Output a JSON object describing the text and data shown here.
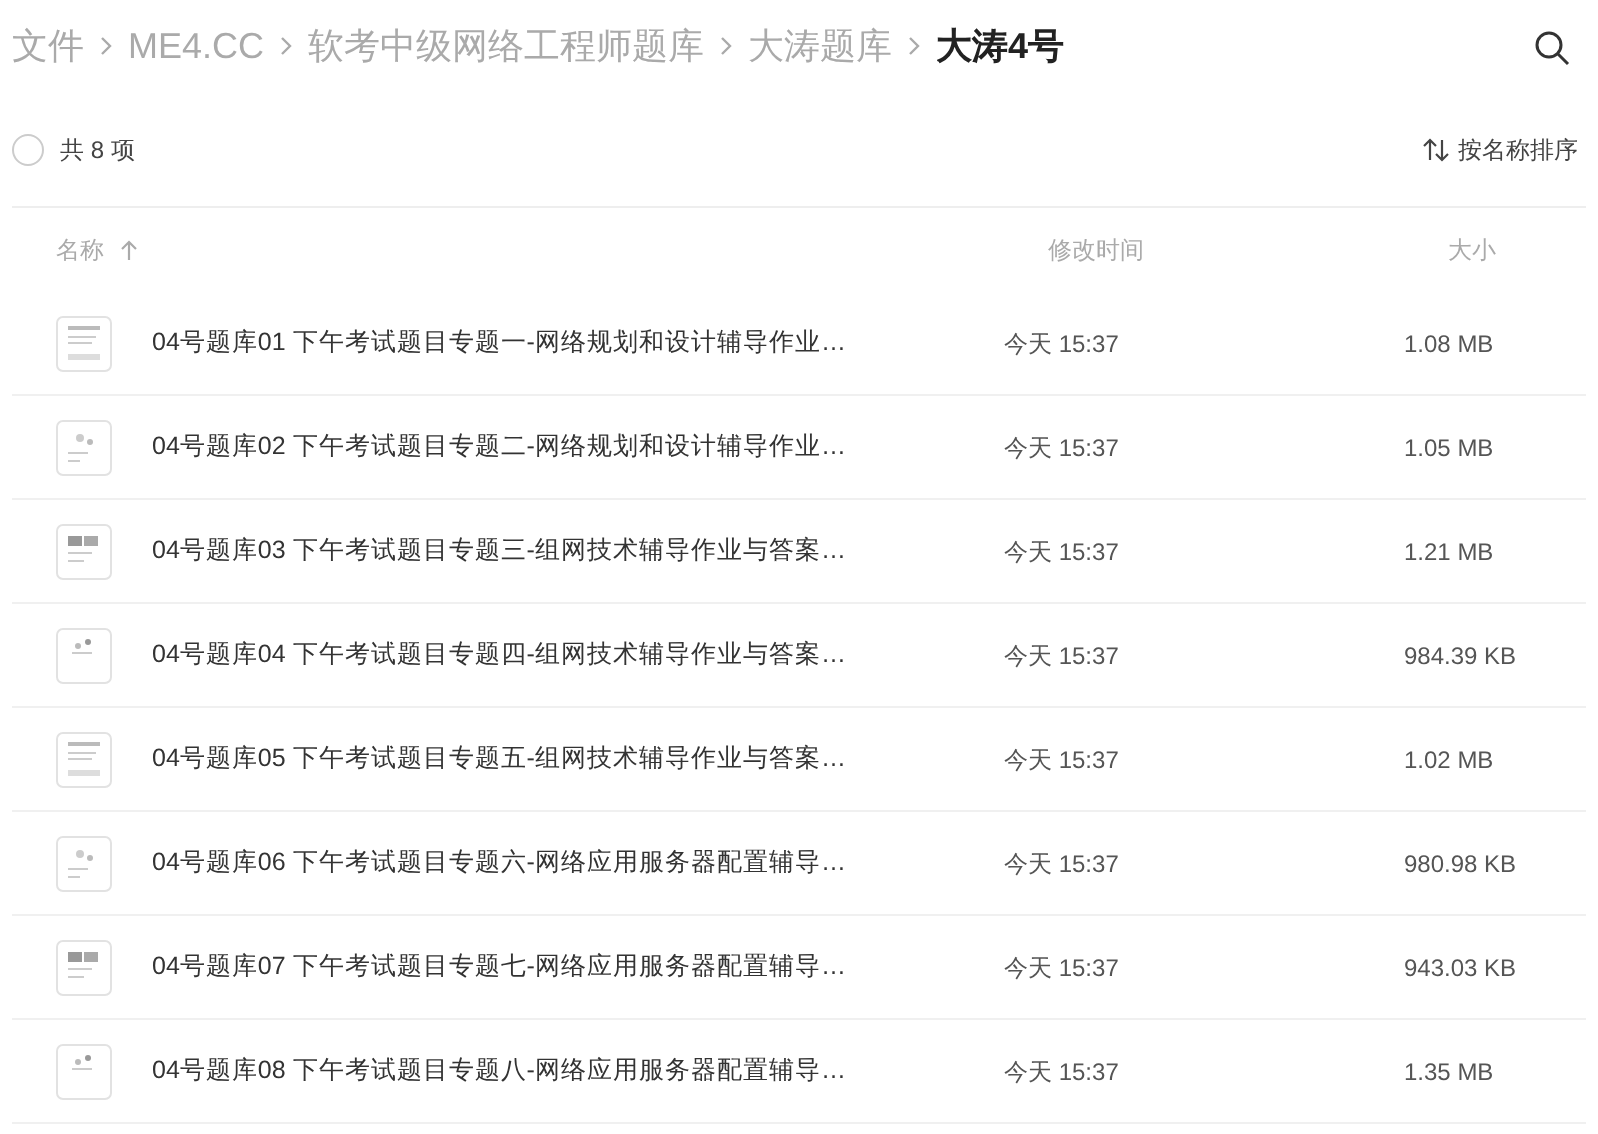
{
  "breadcrumb": [
    {
      "label": "文件",
      "current": false
    },
    {
      "label": "ME4.CC",
      "current": false
    },
    {
      "label": "软考中级网络工程师题库",
      "current": false
    },
    {
      "label": "大涛题库",
      "current": false
    },
    {
      "label": "大涛4号",
      "current": true
    }
  ],
  "selection": {
    "checked": false,
    "count_label": "共 8 项"
  },
  "sort": {
    "label": "按名称排序"
  },
  "columns": [
    {
      "label": "名称",
      "sorted": true
    },
    {
      "label": "修改时间",
      "sorted": false
    },
    {
      "label": "大小",
      "sorted": false
    }
  ],
  "files": [
    {
      "name": "04号题库01 下午考试题目专题一-网络规划和设计辅导作业…",
      "modified": "今天 15:37",
      "size": "1.08 MB"
    },
    {
      "name": "04号题库02 下午考试题目专题二-网络规划和设计辅导作业…",
      "modified": "今天 15:37",
      "size": "1.05 MB"
    },
    {
      "name": "04号题库03 下午考试题目专题三-组网技术辅导作业与答案…",
      "modified": "今天 15:37",
      "size": "1.21 MB"
    },
    {
      "name": "04号题库04 下午考试题目专题四-组网技术辅导作业与答案…",
      "modified": "今天 15:37",
      "size": "984.39 KB"
    },
    {
      "name": "04号题库05 下午考试题目专题五-组网技术辅导作业与答案…",
      "modified": "今天 15:37",
      "size": "1.02 MB"
    },
    {
      "name": "04号题库06 下午考试题目专题六-网络应用服务器配置辅导…",
      "modified": "今天 15:37",
      "size": "980.98 KB"
    },
    {
      "name": "04号题库07 下午考试题目专题七-网络应用服务器配置辅导…",
      "modified": "今天 15:37",
      "size": "943.03 KB"
    },
    {
      "name": "04号题库08 下午考试题目专题八-网络应用服务器配置辅导…",
      "modified": "今天 15:37",
      "size": "1.35 MB"
    }
  ]
}
